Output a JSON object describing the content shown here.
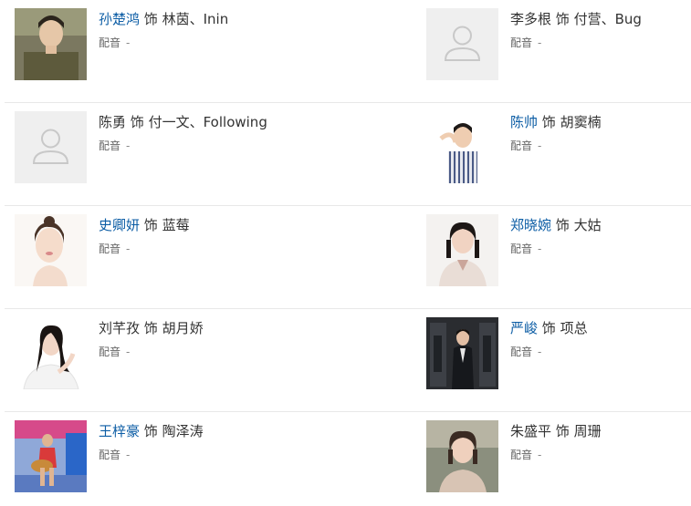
{
  "role_connector": "饰",
  "cast": [
    {
      "actor": "孙楚鸿",
      "actor_linked": true,
      "role": "林茵、Inin",
      "voice_label": "配音",
      "voice_value": "-",
      "photo": "photo-actor"
    },
    {
      "actor": "李多根",
      "actor_linked": false,
      "role": "付营、Bug",
      "voice_label": "配音",
      "voice_value": "-",
      "photo": "avatar-placeholder-icon"
    },
    {
      "actor": "陈勇",
      "actor_linked": false,
      "role": "付一文、Following",
      "voice_label": "配音",
      "voice_value": "-",
      "photo": "avatar-placeholder-icon"
    },
    {
      "actor": "陈帅",
      "actor_linked": true,
      "role": "胡窦楠",
      "voice_label": "配音",
      "voice_value": "-",
      "photo": "photo-actor"
    },
    {
      "actor": "史卿妍",
      "actor_linked": true,
      "role": "蓝莓",
      "voice_label": "配音",
      "voice_value": "-",
      "photo": "photo-actress"
    },
    {
      "actor": "郑晓婉",
      "actor_linked": true,
      "role": "大姑",
      "voice_label": "配音",
      "voice_value": "-",
      "photo": "photo-actress"
    },
    {
      "actor": "刘芊孜",
      "actor_linked": false,
      "role": "胡月娇",
      "voice_label": "配音",
      "voice_value": "-",
      "photo": "photo-actress"
    },
    {
      "actor": "严峻",
      "actor_linked": true,
      "role": "项总",
      "voice_label": "配音",
      "voice_value": "-",
      "photo": "photo-actor"
    },
    {
      "actor": "王梓豪",
      "actor_linked": true,
      "role": "陶泽涛",
      "voice_label": "配音",
      "voice_value": "-",
      "photo": "photo-actor"
    },
    {
      "actor": "朱盛平",
      "actor_linked": false,
      "role": "周珊",
      "voice_label": "配音",
      "voice_value": "-",
      "photo": "photo-actress"
    }
  ],
  "colors": {
    "link": "#0c5da5",
    "text": "#333333",
    "muted": "#888888",
    "divider": "#e8e8e8",
    "placeholder_bg": "#efefef"
  }
}
